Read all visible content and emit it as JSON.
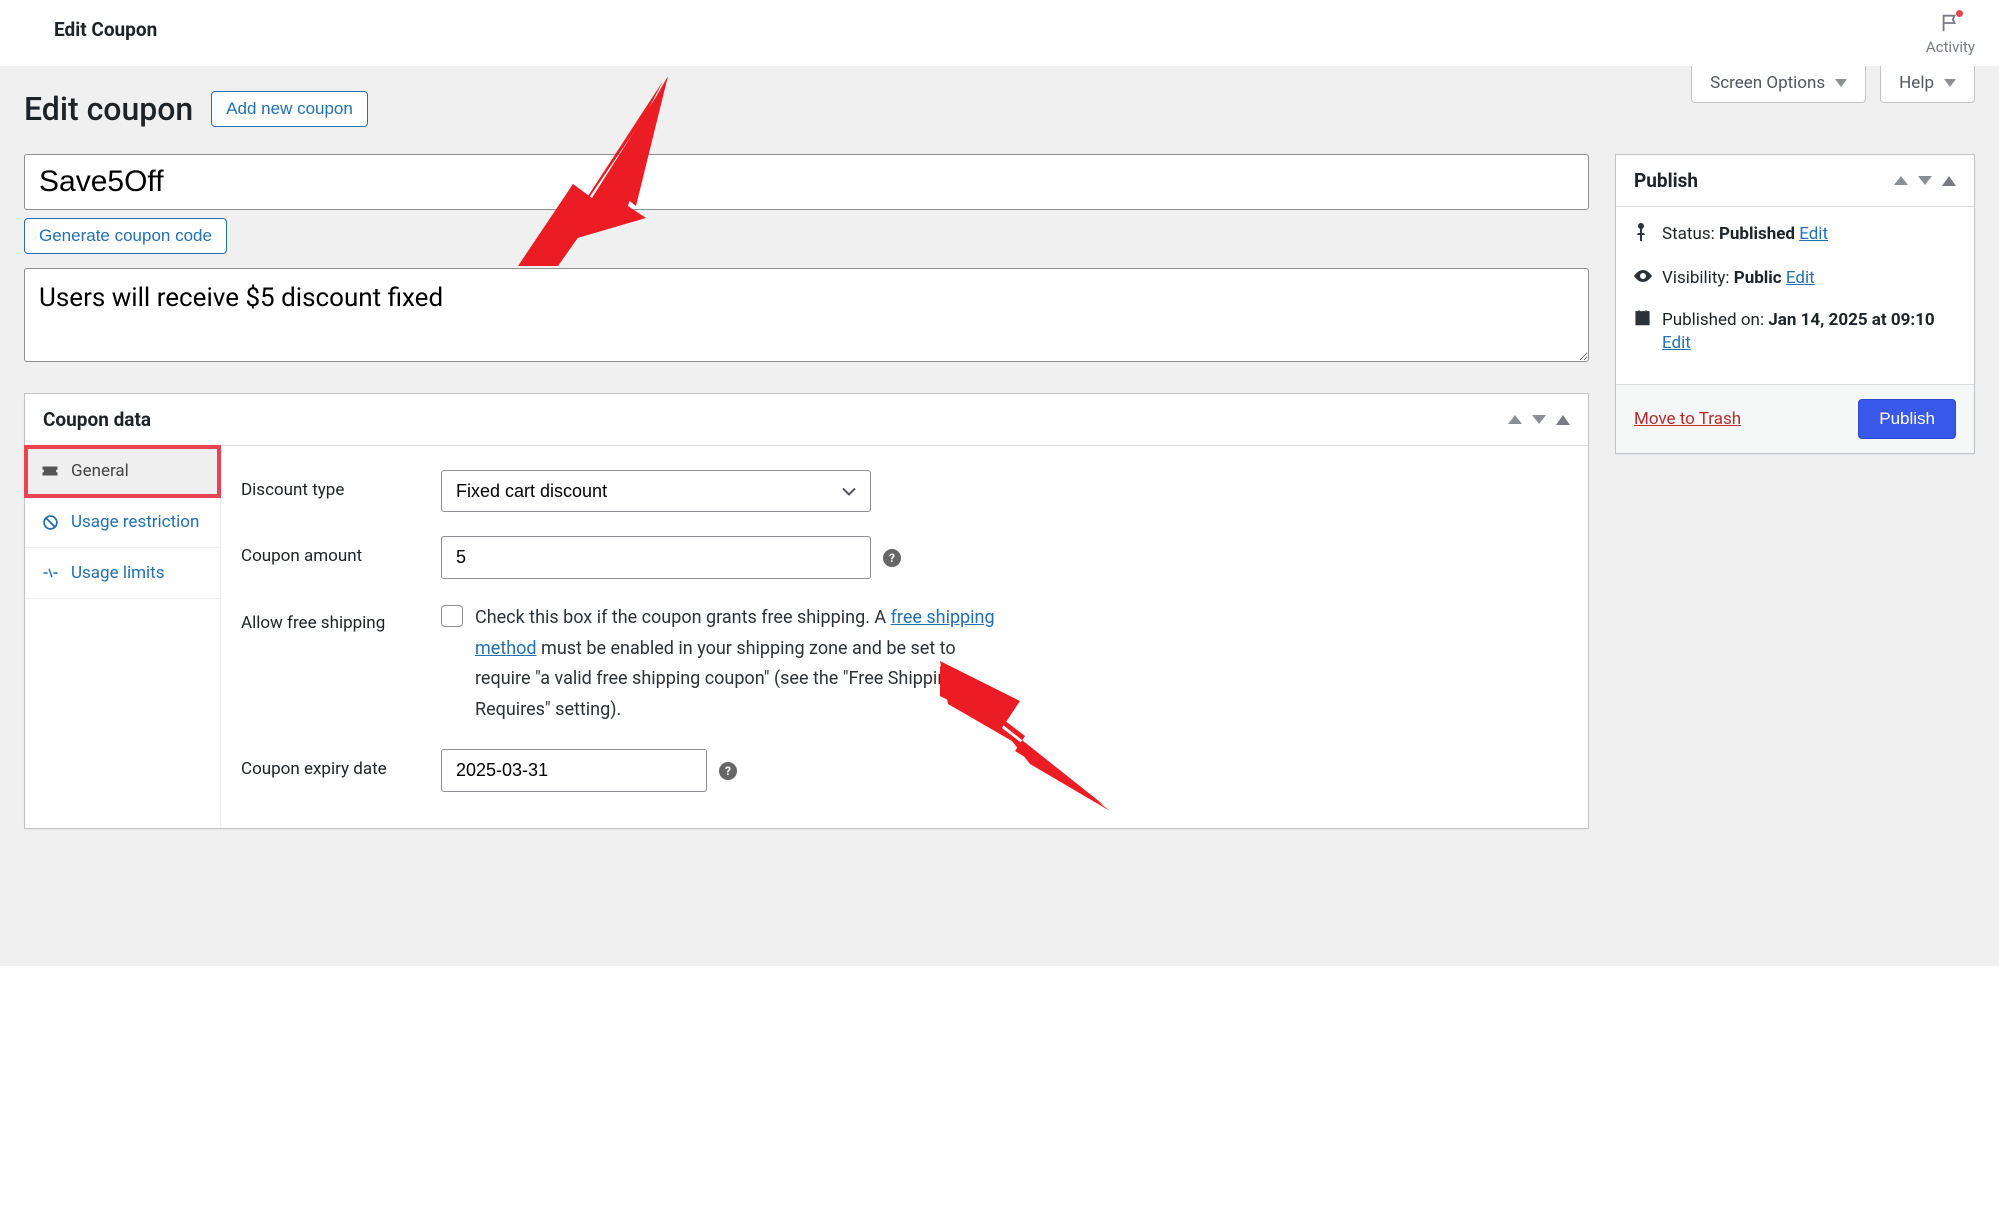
{
  "topbar": {
    "title": "Edit Coupon",
    "activity_label": "Activity"
  },
  "screen_tabs": {
    "options": "Screen Options",
    "help": "Help"
  },
  "header": {
    "heading": "Edit coupon",
    "add_button": "Add new coupon"
  },
  "title_input": {
    "value": "Save5Off"
  },
  "generate_button": "Generate coupon code",
  "description": {
    "value": "Users will receive $5 discount fixed"
  },
  "coupon_box": {
    "title": "Coupon data",
    "tabs": {
      "general": "General",
      "usage_restriction": "Usage restriction",
      "usage_limits": "Usage limits"
    },
    "fields": {
      "discount_type": {
        "label": "Discount type",
        "selected": "Fixed cart discount"
      },
      "coupon_amount": {
        "label": "Coupon amount",
        "value": "5"
      },
      "allow_free_shipping": {
        "label": "Allow free shipping",
        "text_before": "Check this box if the coupon grants free shipping. A ",
        "link_text": "free shipping method",
        "text_after": " must be enabled in your shipping zone and be set to require \"a valid free shipping coupon\" (see the \"Free Shipping Requires\" setting)."
      },
      "expiry": {
        "label": "Coupon expiry date",
        "value": "2025-03-31"
      }
    }
  },
  "publish_box": {
    "title": "Publish",
    "status_label": "Status:",
    "status_value": "Published",
    "status_edit": "Edit",
    "visibility_label": "Visibility:",
    "visibility_value": "Public",
    "visibility_edit": "Edit",
    "published_label": "Published on:",
    "published_value": "Jan 14, 2025 at 09:10",
    "published_edit": "Edit",
    "trash": "Move to Trash",
    "publish_button": "Publish"
  }
}
